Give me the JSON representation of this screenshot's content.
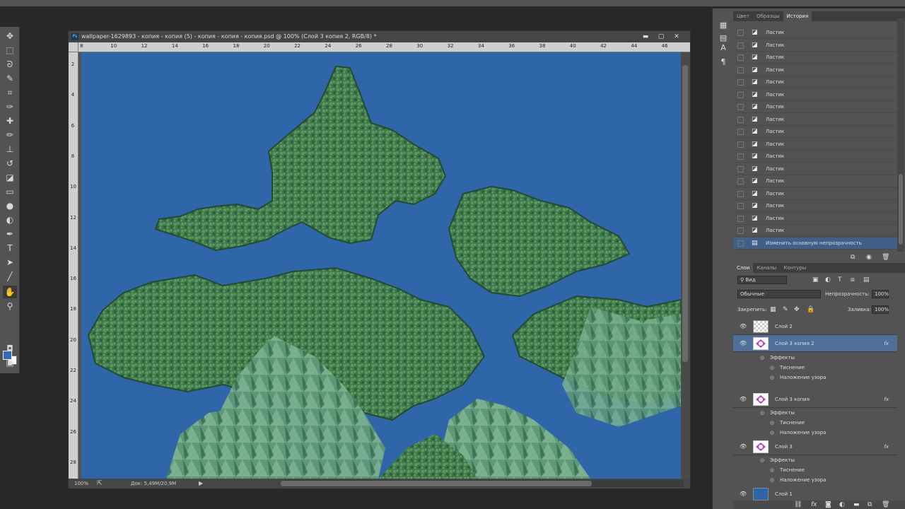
{
  "document": {
    "title": "wallpaper-1629893 - копия - копия (5) - копия - копия - копия.psd @ 100% (Слой 3 копия 2, RGB/8) *",
    "ruler_h": [
      "8",
      "10",
      "12",
      "14",
      "16",
      "18",
      "20",
      "22",
      "24",
      "26",
      "28",
      "30",
      "32",
      "34",
      "36",
      "38",
      "40",
      "42",
      "44",
      "46"
    ],
    "ruler_v": [
      "2",
      "4",
      "6",
      "8",
      "10",
      "12",
      "14",
      "16",
      "18",
      "20",
      "22",
      "24",
      "26",
      "28"
    ],
    "zoom": "100%",
    "doc_size": "Док: 5,49M/20,9M"
  },
  "panels": {
    "top_tabs": [
      "Цвет",
      "Образцы",
      "История"
    ],
    "history": {
      "items": [
        "Ластик",
        "Ластик",
        "Ластик",
        "Ластик",
        "Ластик",
        "Ластик",
        "Ластик",
        "Ластик",
        "Ластик",
        "Ластик",
        "Ластик",
        "Ластик",
        "Ластик",
        "Ластик",
        "Ластик",
        "Ластик",
        "Ластик"
      ],
      "last_item": "Изменить основную непрозрачность"
    },
    "layers_tabs": [
      "Слои",
      "Каналы",
      "Контуры"
    ],
    "kind_filter": "Вид",
    "blend_mode": "Обычные",
    "opacity_label": "Непрозрачность:",
    "opacity_value": "100%",
    "lock_label": "Закрепить:",
    "fill_label": "Заливка:",
    "fill_value": "100%",
    "layers": [
      {
        "name": "Слой 2"
      },
      {
        "name": "Слой 3 копия 2"
      },
      {
        "name": "Слой 3 копия"
      },
      {
        "name": "Слой 3"
      },
      {
        "name": "Слой 1"
      }
    ],
    "effects_label": "Эффекты",
    "effect_emboss": "Тиснение",
    "effect_pattern": "Наложение узора",
    "fx_label": "fx"
  },
  "colors": {
    "canvas_bg": "#2e66a9",
    "foreground": "#2f6db6",
    "selection": "#4f6f99"
  }
}
